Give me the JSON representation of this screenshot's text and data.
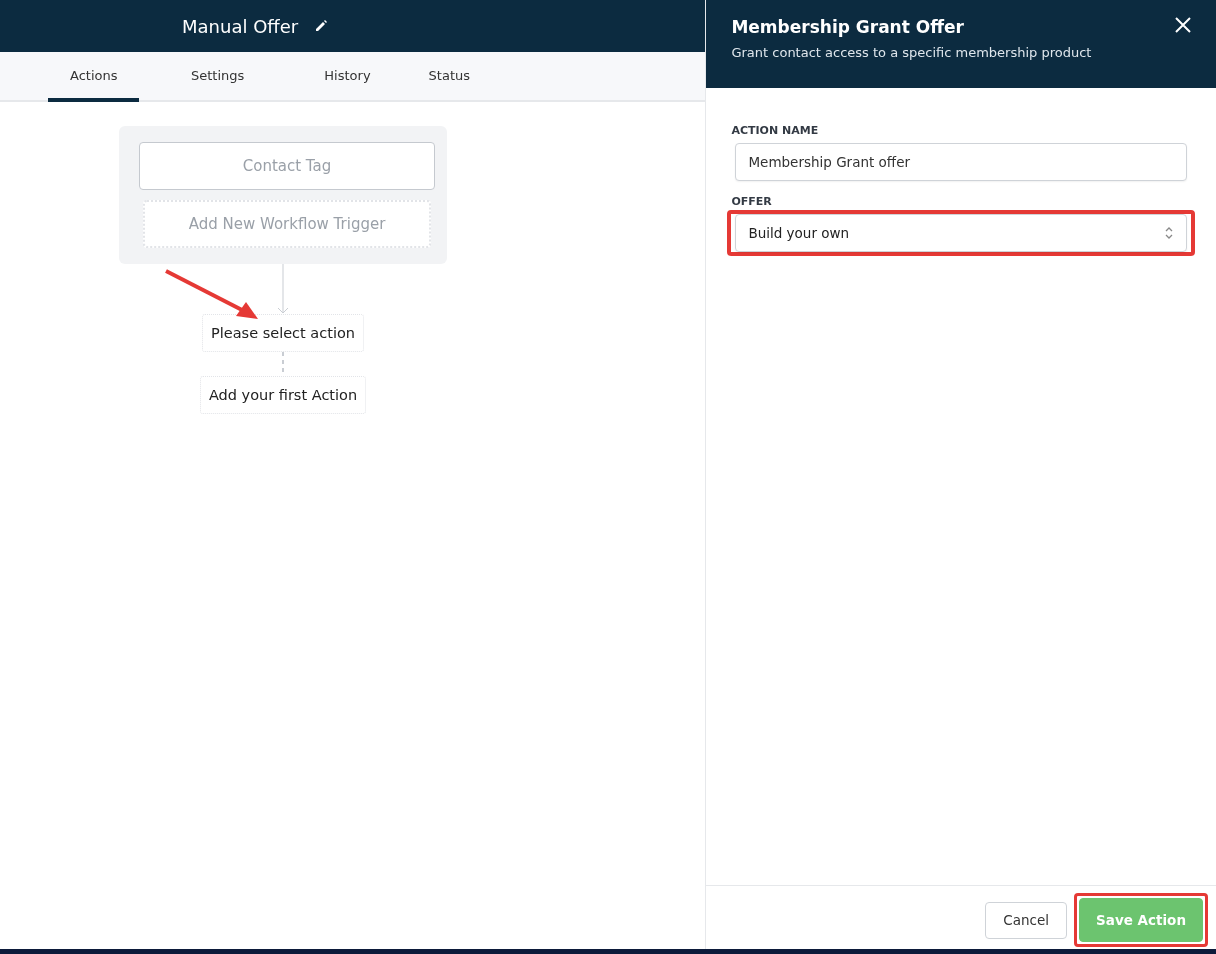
{
  "workflow": {
    "title": "Manual Offer"
  },
  "tabs": [
    {
      "label": "Actions",
      "selected": true
    },
    {
      "label": "Settings",
      "selected": false
    },
    {
      "label": "History",
      "selected": false
    },
    {
      "label": "Status",
      "selected": false
    }
  ],
  "triggers": [
    {
      "label": "Contact Tag",
      "kind": "trigger"
    },
    {
      "label": "Add New Workflow Trigger",
      "kind": "add"
    }
  ],
  "actions": [
    {
      "label": "Please select action",
      "annotated": true
    },
    {
      "label": "Add your first Action",
      "annotated": false
    }
  ],
  "drawer": {
    "title": "Membership Grant Offer",
    "subtitle": "Grant contact access to a specific membership product",
    "fields": [
      {
        "label": "ACTION NAME",
        "kind": "text",
        "value": "Membership Grant offer",
        "highlighted": false
      },
      {
        "label": "OFFER",
        "kind": "select",
        "value": "Build your own",
        "highlighted": true
      }
    ],
    "buttons": [
      {
        "label": "Cancel",
        "kind": "secondary",
        "highlighted": false
      },
      {
        "label": "Save Action",
        "kind": "primary",
        "highlighted": true
      }
    ]
  }
}
